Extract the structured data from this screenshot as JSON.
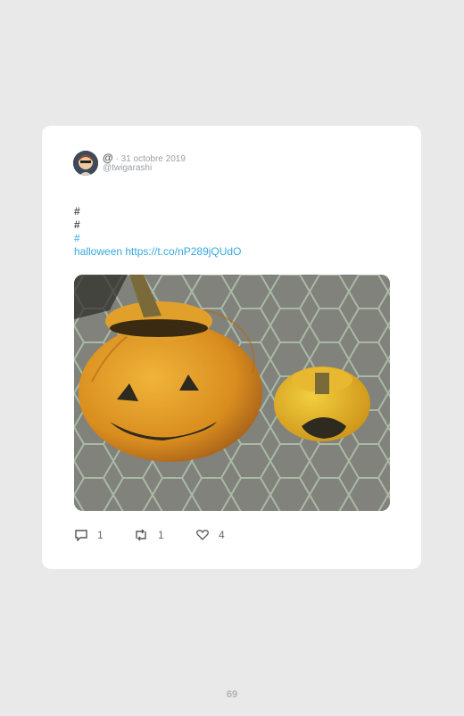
{
  "tweet": {
    "author_symbol": "@",
    "separator": "·",
    "date": "31 octobre 2019",
    "handle": "@twigarashi",
    "lines": [
      "#",
      "#",
      "#"
    ],
    "link_text": "halloween https://t.co/nP289jQUdO",
    "image_alt": "two carved pumpkins on tile floor"
  },
  "actions": {
    "reply_count": "1",
    "retweet_count": "1",
    "like_count": "4"
  },
  "page": {
    "number": "69"
  },
  "colors": {
    "link": "#35a8e0",
    "background": "#e9e9e9",
    "card": "#ffffff"
  }
}
